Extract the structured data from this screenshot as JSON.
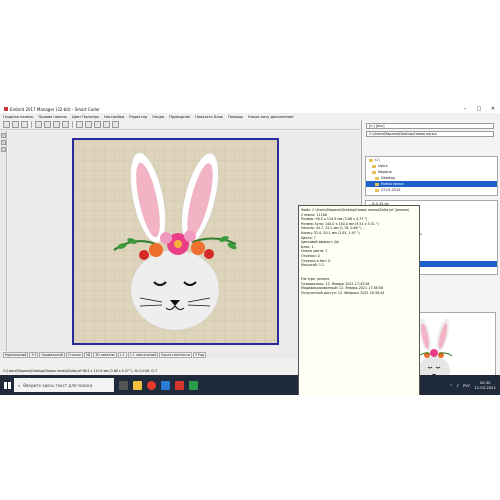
{
  "window": {
    "title": "Embird 2017 Manager (32-bit) - Smart Coder",
    "controls": [
      "–",
      "□",
      "✕"
    ]
  },
  "menu": [
    "Гродная панель",
    "Правая панель",
    "Цвет Палитры",
    "Настройки",
    "Редактор",
    "Опция",
    "Проводник",
    "Показать Блок",
    "Помощь",
    "Какое хочу дополнение"
  ],
  "right_panel": {
    "drive": "[c:] [dvc]",
    "folder_path": "C:\\Users\\Марина\\Desktop\\Новая папка",
    "tree": [
      {
        "label": "C:\\",
        "indent": 0,
        "selected": false
      },
      {
        "label": "Users",
        "indent": 1,
        "selected": false
      },
      {
        "label": "Марина",
        "indent": 1,
        "selected": false
      },
      {
        "label": "Desktop",
        "indent": 2,
        "selected": false
      },
      {
        "label": "Новая папка",
        "indent": 2,
        "selected": true
      },
      {
        "label": "27.01.2015",
        "indent": 2,
        "selected": false
      }
    ],
    "files": [
      {
        "name": "...8-4-43.dp",
        "selected": false
      },
      {
        "name": "...9-2394.dp",
        "selected": false
      },
      {
        "name": "...NNEy.dp",
        "selected": false
      },
      {
        "name": "...2394_fsh2_3394.dp",
        "selected": false
      },
      {
        "name": "...9",
        "selected": false
      },
      {
        "name": "...VKBV_HAIT_3394_9-9-228.dp",
        "selected": false
      },
      {
        "name": "...",
        "selected": false
      },
      {
        "name": "...",
        "selected": false
      },
      {
        "name": "...",
        "selected": false
      },
      {
        "name": "...",
        "selected": false
      },
      {
        "name": "Zaika.jef",
        "selected": true
      }
    ]
  },
  "tooltip": [
    "Файл: C:\\Users\\Марина\\Desktop\\Новая папка\\Zaika.jef (Janome)",
    "Стежки: 11108",
    "Размер: 98.5 x 110.9 мм (3.88 x 4.37 \")",
    "Размер Хупа: 140.0 x 140.0 мм (5.51 x 5.51 \")",
    "Начало: 44.7, 15.2 мм (1.76, 0.60 \")",
    "Конец: 52.0, 50.1 мм (2.05, 1.97 \")",
    "Цвета: 7",
    "Цветовой эффект: Да",
    "Блок: 1",
    "Смена цвета: 7",
    "Отрезки: 0",
    "Отрезки в Нит: 0",
    "Масштаб: 1:1",
    "",
    "",
    "File type: Janome",
    "Создавались: 12. Январь 2021 17:43:58",
    "Модифицированный: 12. Январь 2021 17:38:58",
    "Полученный доступ: 12. Февраль 2021 20:30:44"
  ],
  "palette": [
    "#cc1e1e",
    "#3a9a3a",
    "#e93f88",
    "#f0a8c8",
    "#1a1a1a",
    "#ffffff",
    "#e8a33a",
    "#ffffff"
  ],
  "tabs": [
    "Нормальный",
    "3:1",
    "Нормальный",
    "Стежки",
    "3D",
    "3D пиксели",
    "1:1",
    "1:1 пиксельный",
    "Карта плотности",
    "3 Ряд"
  ],
  "status": "C:\\Users\\Марина\\Desktop\\Новая папка\\Zaika.jef 98.5 x 110.9 мм (3.88 x 4.37 \"). St:11108, Cl:7",
  "taskbar": {
    "search_placeholder": "Введите здесь текст для поиска",
    "lang": "РУС",
    "time": "20:30",
    "date": "12.03.2021"
  },
  "colors": {
    "hoop_fabric": "#ddd4bb",
    "hoop_border": "#2a2aa0",
    "selection": "#1e62c9",
    "taskbar": "#1f2a3a"
  }
}
